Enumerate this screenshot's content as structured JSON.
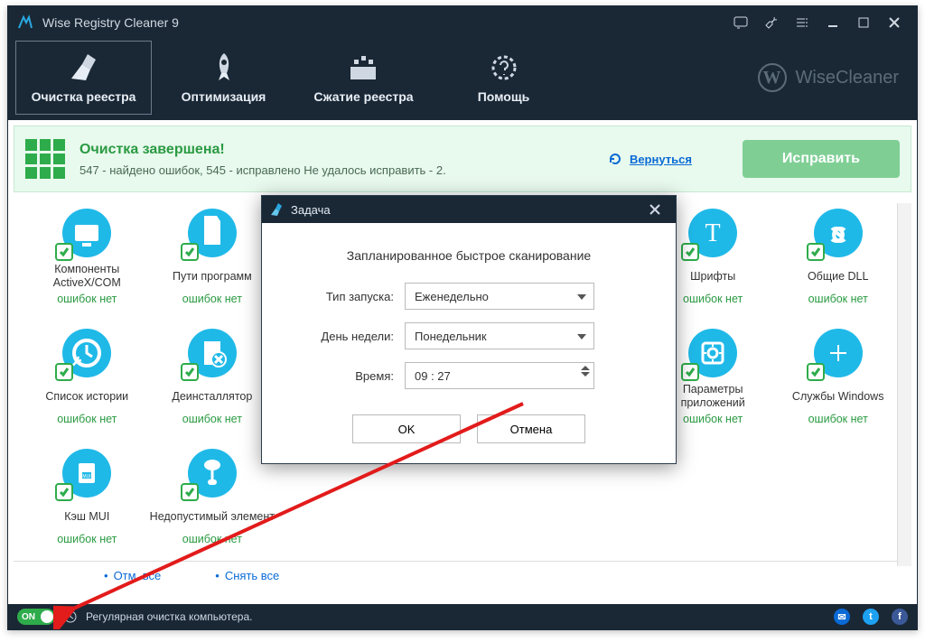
{
  "title": "Wise Registry Cleaner 9",
  "brand": "WiseCleaner",
  "nav": {
    "items": [
      {
        "label": "Очистка реестра"
      },
      {
        "label": "Оптимизация"
      },
      {
        "label": "Сжатие реестра"
      },
      {
        "label": "Помощь"
      }
    ]
  },
  "status": {
    "title": "Очистка завершена!",
    "sub": "547 - найдено ошибок, 545 - исправлено Не удалось исправить - 2.",
    "return": "Вернуться",
    "fix": "Исправить"
  },
  "items": [
    {
      "name": "Компоненты ActiveX/COM",
      "stat": "ошибок нет"
    },
    {
      "name": "Пути программ",
      "stat": "ошибок нет"
    },
    {
      "name": "",
      "stat": ""
    },
    {
      "name": "",
      "stat": ""
    },
    {
      "name": "",
      "stat": ""
    },
    {
      "name": "Шрифты",
      "stat": "ошибок нет"
    },
    {
      "name": "Общие DLL",
      "stat": "ошибок нет"
    },
    {
      "name": "Список истории",
      "stat": "ошибок нет"
    },
    {
      "name": "Деинсталлятор",
      "stat": "ошибок нет"
    },
    {
      "name": "",
      "stat": ""
    },
    {
      "name": "",
      "stat": ""
    },
    {
      "name": "",
      "stat": ""
    },
    {
      "name": "Параметры приложений",
      "stat": "ошибок нет"
    },
    {
      "name": "Службы Windows",
      "stat": "ошибок нет"
    },
    {
      "name": "Кэш MUI",
      "stat": "ошибок нет"
    },
    {
      "name": "Недопустимый элемент",
      "stat": "ошибок нет"
    }
  ],
  "footer": {
    "checkAll": "Отм. все",
    "uncheckAll": "Снять все"
  },
  "bottom": {
    "toggle": "ON",
    "text": "Регулярная очистка компьютера."
  },
  "dialog": {
    "title": "Задача",
    "heading": "Запланированное быстрое сканирование",
    "typeLabel": "Тип запуска:",
    "typeValue": "Еженедельно",
    "dayLabel": "День недели:",
    "dayValue": "Понедельник",
    "timeLabel": "Время:",
    "timeValue": "09 : 27",
    "ok": "OK",
    "cancel": "Отмена"
  }
}
